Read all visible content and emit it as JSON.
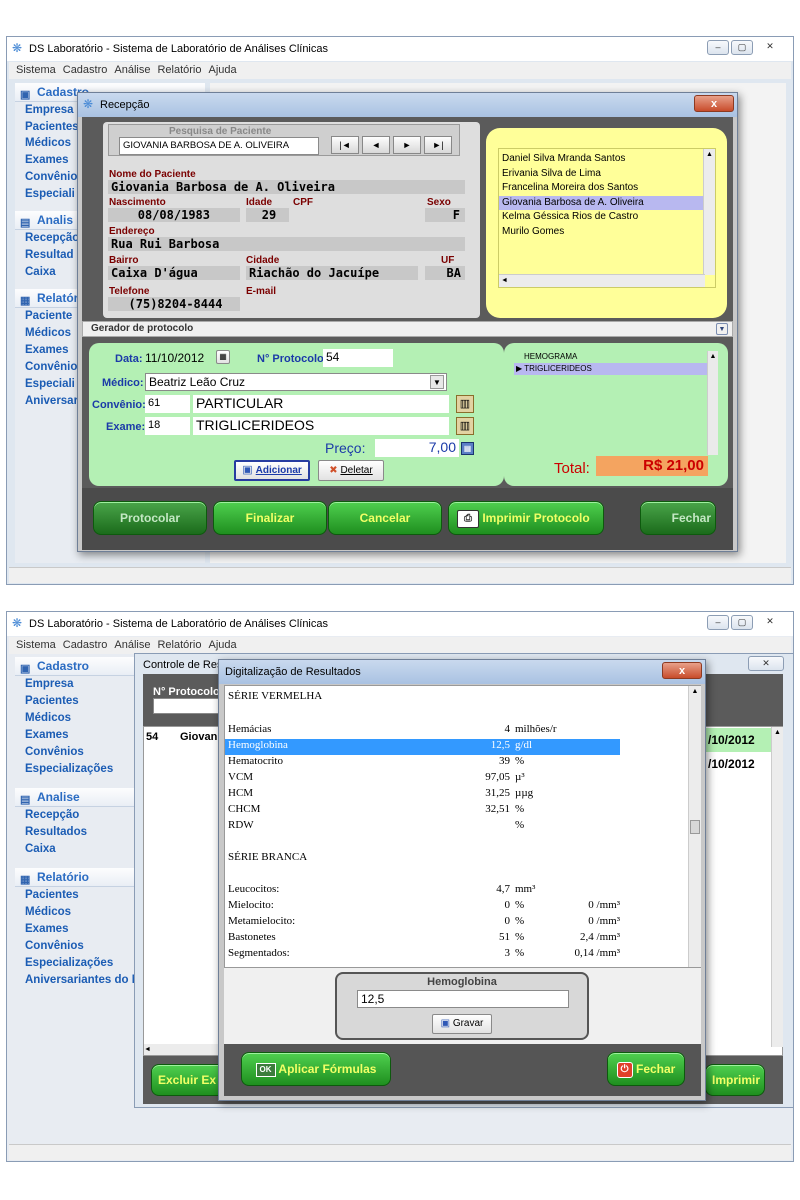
{
  "app_title": "DS Laboratório - Sistema de Laboratório de Análises Clínicas",
  "menu": [
    "Sistema",
    "Cadastro",
    "Análise",
    "Relatório",
    "Ajuda"
  ],
  "sidebar": {
    "cadastro": {
      "title": "Cadastro",
      "items": [
        "Empresa",
        "Pacientes",
        "Médicos",
        "Exames",
        "Convênios",
        "Especializações"
      ]
    },
    "analise": {
      "title": "Analise",
      "items": [
        "Recepção",
        "Resultados",
        "Caixa"
      ]
    },
    "relatorio": {
      "title": "Relatório",
      "items": [
        "Pacientes",
        "Médicos",
        "Exames",
        "Convênios",
        "Especializações",
        "Aniversariantes do Mês"
      ]
    }
  },
  "sidebar_top": {
    "cadastro": {
      "title": "Cadastro",
      "items": [
        "Empresa",
        "Pacientes",
        "Médicos",
        "Exames",
        "Convênio",
        "Especiali"
      ]
    },
    "analise": {
      "title": "Analis",
      "items": [
        "Recepção",
        "Resultad",
        "Caixa"
      ]
    },
    "relatorio": {
      "title": "Relatór",
      "items": [
        "Paciente",
        "Médicos",
        "Exames",
        "Convênio",
        "Especiali",
        "Aniversar"
      ]
    }
  },
  "recepcao": {
    "title": "Recepção",
    "search_title": "Pesquisa de Paciente",
    "search_value": "GIOVANIA BARBOSA DE A. OLIVEIRA",
    "nav": [
      "|◄",
      "◄",
      "►",
      "►|"
    ],
    "patients": [
      "Daniel Silva Mranda Santos",
      "Erivania Silva de Lima",
      "Francelina Moreira dos Santos",
      "Giovania Barbosa de A. Oliveira",
      "Kelma Géssica Rios de Castro",
      "Murilo Gomes"
    ],
    "selected_index": 3,
    "labels": {
      "nome": "Nome do Paciente",
      "nascimento": "Nascimento",
      "idade": "Idade",
      "cpf": "CPF",
      "sexo": "Sexo",
      "endereco": "Endereço",
      "bairro": "Bairro",
      "cidade": "Cidade",
      "uf": "UF",
      "telefone": "Telefone",
      "email": "E-mail"
    },
    "values": {
      "nome": "Giovania Barbosa de A. Oliveira",
      "nascimento": "08/08/1983",
      "idade": "29",
      "cpf": "",
      "sexo": "F",
      "endereco": "Rua Rui Barbosa",
      "bairro": "Caixa D'água",
      "cidade": "Riachão do Jacuípe",
      "uf": "BA",
      "telefone": "(75)8204-8444",
      "email": ""
    },
    "gerador_title": "Gerador de protocolo",
    "data_label": "Data:",
    "data_value": "11/10/2012",
    "protocolo_label": "N° Protocolo:",
    "protocolo_value": "54",
    "medico_label": "Médico:",
    "medico_value": "Beatriz Leão Cruz",
    "convenio_label": "Convênio:",
    "convenio_code": "61",
    "convenio_name": "PARTICULAR",
    "exame_label": "Exame:",
    "exame_code": "18",
    "exame_name": "TRIGLICERIDEOS",
    "preco_label": "Preço:",
    "preco_value": "7,00",
    "exams": [
      "HEMOGRAMA",
      "TRIGLICERIDEOS"
    ],
    "exam_selected": 1,
    "adicionar": "Adicionar",
    "deletar": "Deletar",
    "total_label": "Total:",
    "total_value": "R$ 21,00",
    "buttons": [
      "Protocolar",
      "Finalizar",
      "Cancelar",
      "Imprimir Protocolo",
      "Fechar"
    ]
  },
  "controle": {
    "title": "Controle de Resu",
    "protocolo_label": "N° Protocolo",
    "row_num": "54",
    "row_name": "Giovani",
    "dates": [
      "/10/2012",
      "/10/2012"
    ],
    "excluir": "Excluir Ex",
    "imprimir": "Imprimir"
  },
  "resultados": {
    "title": "Digitalização de Resultados",
    "serie_vermelha": "SÉRIE VERMELHA",
    "rows_v": [
      {
        "name": "Hemácias",
        "value": "4",
        "unit": "milhões/r"
      },
      {
        "name": "Hemoglobina",
        "value": "12,5",
        "unit": "g/dl"
      },
      {
        "name": "Hematocrito",
        "value": "39",
        "unit": "%"
      },
      {
        "name": "VCM",
        "value": "97,05",
        "unit": "µ³"
      },
      {
        "name": "HCM",
        "value": "31,25",
        "unit": "µµg"
      },
      {
        "name": "CHCM",
        "value": "32,51",
        "unit": "%"
      },
      {
        "name": "RDW",
        "value": "",
        "unit": "%"
      }
    ],
    "selected_row": 1,
    "serie_branca": "SÉRIE BRANCA",
    "rows_b": [
      {
        "name": "Leucocitos:",
        "value": "4,7",
        "unit": "mm³",
        "abs": ""
      },
      {
        "name": "Mielocito:",
        "value": "0",
        "unit": "%",
        "abs": "0 /mm³"
      },
      {
        "name": "Metamielocito:",
        "value": "0",
        "unit": "%",
        "abs": "0 /mm³"
      },
      {
        "name": "Bastonetes",
        "value": "51",
        "unit": "%",
        "abs": "2,4 /mm³"
      },
      {
        "name": "Segmentados:",
        "value": "3",
        "unit": "%",
        "abs": "0,14 /mm³"
      }
    ],
    "edit_title": "Hemoglobina",
    "edit_value": "12,5",
    "gravar": "Gravar",
    "aplicar": "Aplicar Fórmulas",
    "aplicar_badge": "OK",
    "fechar": "Fechar"
  }
}
